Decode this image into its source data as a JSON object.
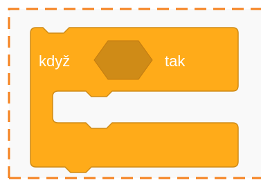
{
  "block": {
    "kind": "control-if",
    "label_if": "když",
    "label_then": "tak",
    "fill_color": "#FFAB19",
    "stroke_color": "#CF8B17",
    "slot_color": "#CF8B17"
  },
  "drop_zone": {
    "border_color": "#F5821F",
    "background_color": "#F9F9F9"
  }
}
